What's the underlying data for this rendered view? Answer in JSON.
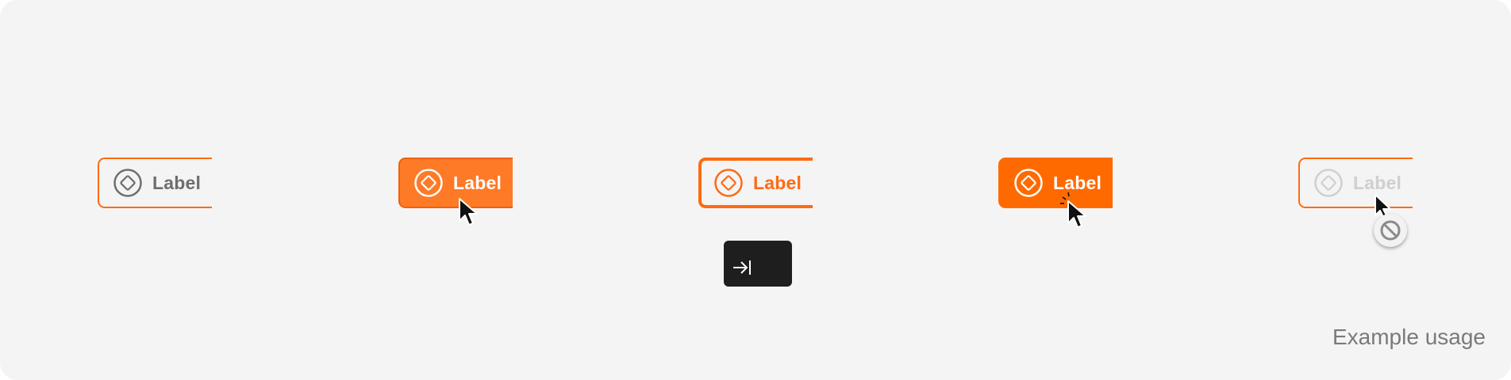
{
  "buttons": [
    {
      "state": "default",
      "label": "Label",
      "icon": "diamond-circle-icon"
    },
    {
      "state": "hover",
      "label": "Label",
      "icon": "diamond-circle-icon"
    },
    {
      "state": "focus",
      "label": "Label",
      "icon": "diamond-circle-icon"
    },
    {
      "state": "pressed",
      "label": "Label",
      "icon": "diamond-circle-icon"
    },
    {
      "state": "disabled",
      "label": "Label",
      "icon": "diamond-circle-icon"
    }
  ],
  "indicators": {
    "hover_cursor": "pointer-cursor-icon",
    "pressed_cursor": "pointer-click-cursor-icon",
    "focus_key": "tab-key-icon",
    "disabled_cursor": "not-allowed-icon"
  },
  "caption": "Example usage",
  "colors": {
    "background": "#f4f4f4",
    "accent": "#ff6a13",
    "hover_fill": "#ff7a26",
    "pressed_fill": "#ff6a00",
    "default_text": "#6e6e6e",
    "disabled_text": "#cfcfcf",
    "key_background": "#1e1e1e"
  }
}
